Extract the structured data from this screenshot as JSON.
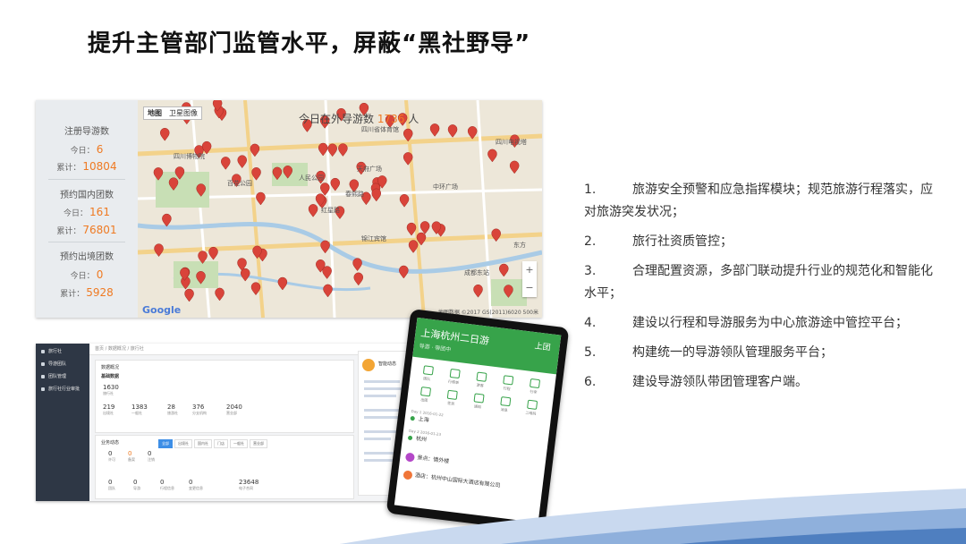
{
  "title": "提升主管部门监管水平，屏蔽“黑社野导”",
  "stats_panel": {
    "blocks": [
      {
        "title": "注册导游数",
        "today_label": "今日：",
        "today_value": "6",
        "total_label": "累计：",
        "total_value": "10804"
      },
      {
        "title": "预约国内团数",
        "today_label": "今日：",
        "today_value": "161",
        "total_label": "累计：",
        "total_value": "76801"
      },
      {
        "title": "预约出境团数",
        "today_label": "今日：",
        "today_value": "0",
        "total_label": "累计：",
        "total_value": "5928"
      }
    ]
  },
  "map": {
    "toggle": [
      "地图",
      "卫星图像"
    ],
    "banner_prefix": "今日在外导游数",
    "banner_count": "1736",
    "banner_suffix": "人",
    "labels": [
      "四川博物院",
      "四川电视塔",
      "天府广场",
      "中环广场",
      "锦江宾馆",
      "成都东站",
      "东方",
      "四川省体育馆",
      "百花公园",
      "人民公园",
      "红星路",
      "春熙路"
    ],
    "google": "Google",
    "copyright": "地图数据 ©2017 GS(2011)6020  500米",
    "zoom": [
      "+",
      "−"
    ]
  },
  "admin": {
    "sidebar": [
      "旅行社",
      "导游团队",
      "团队管理",
      "旅行社行业审批"
    ],
    "breadcrumb": "首页 / 数据概况 / 旅行社",
    "section_title": "数据概况",
    "subtitle": "基础数据",
    "big_metric": {
      "value": "1630",
      "label": "旅行社"
    },
    "metrics": [
      {
        "value": "219",
        "label": "出境社"
      },
      {
        "value": "1383",
        "label": "一般社"
      },
      {
        "value": "28",
        "label": "旅游社"
      },
      {
        "value": "376",
        "label": "分支机构"
      },
      {
        "value": "2040",
        "label": "营业部"
      }
    ],
    "business_title": "业务动态",
    "tabs": [
      "全部",
      "出境社",
      "国内社",
      "门店",
      "一般社",
      "营业部"
    ],
    "small_metrics": [
      {
        "value": "0",
        "label": "许可"
      },
      {
        "value": "0",
        "label": "备案"
      },
      {
        "value": "0",
        "label": "注销"
      }
    ],
    "bottom_metrics": [
      {
        "value": "0",
        "label": "团队"
      },
      {
        "value": "0",
        "label": "导游"
      },
      {
        "value": "0",
        "label": "行程信息"
      },
      {
        "value": "0",
        "label": "变更信息"
      },
      {
        "value": "23648",
        "label": "电子合同"
      }
    ],
    "notice_title": "智能动态"
  },
  "phone": {
    "title": "上海杭州二日游",
    "title_right": "上团",
    "subtitle": "导游 · 带团中",
    "icons": [
      "团队",
      "行程单",
      "游客",
      "行程",
      "行李",
      "出团",
      "签到",
      "通知",
      "消息",
      "二维码"
    ],
    "day1": "Day 1 2016-01-22",
    "stop1": "上海",
    "day2": "Day 2 2016-01-23",
    "stop2": "杭州",
    "spot_prefix": "景点：",
    "spot": "情外楼",
    "hotel_prefix": "酒店：",
    "hotel": "杭州中山国际大酒店有限公司"
  },
  "features": [
    {
      "num": "1.",
      "text": "旅游安全预警和应急指挥模块；规范旅游行程落实，应对旅游突发状况；"
    },
    {
      "num": "2.",
      "text": "旅行社资质管控；"
    },
    {
      "num": "3.",
      "text": "合理配置资源，多部门联动提升行业的规范化和智能化水平；"
    },
    {
      "num": "4.",
      "text": "建设以行程和导游服务为中心旅游途中管控平台；"
    },
    {
      "num": "5.",
      "text": "构建统一的导游领队管理服务平台；"
    },
    {
      "num": "6.",
      "text": "建设导游领队带团管理客户端。"
    }
  ],
  "colors": {
    "accent_orange": "#ef7a22",
    "phone_green": "#37a34a",
    "pin_red": "#d9443a",
    "wave_blue": "#4f7fc0"
  }
}
